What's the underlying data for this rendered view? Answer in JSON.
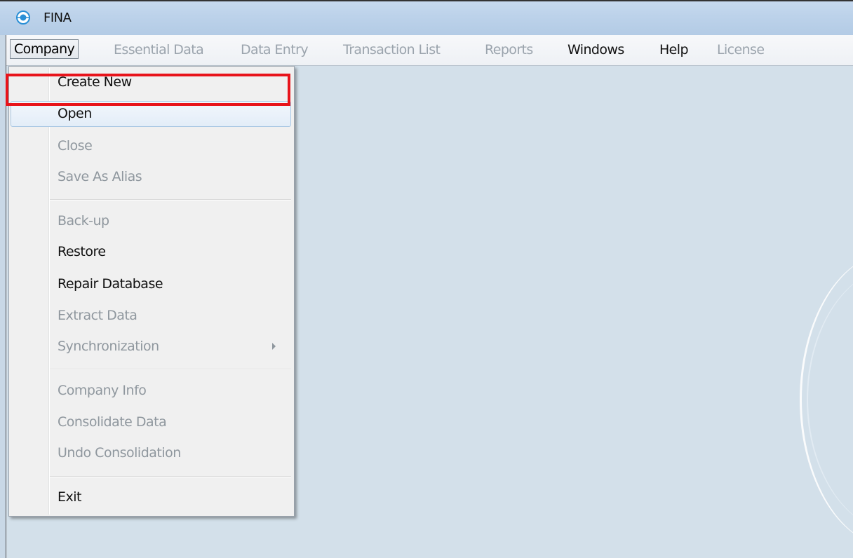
{
  "window": {
    "title": "FINA"
  },
  "menubar": {
    "items": [
      {
        "label": "Company",
        "state": "open"
      },
      {
        "label": "Essential Data",
        "state": "disabled"
      },
      {
        "label": "Data Entry",
        "state": "disabled"
      },
      {
        "label": "Transaction List",
        "state": "disabled"
      },
      {
        "label": "Reports",
        "state": "disabled"
      },
      {
        "label": "Windows",
        "state": "enabled"
      },
      {
        "label": "Help",
        "state": "enabled"
      },
      {
        "label": "License",
        "state": "disabled"
      }
    ]
  },
  "company_menu": {
    "items": [
      {
        "label": "Create New",
        "state": "enabled",
        "highlighted": true
      },
      {
        "label": "Open",
        "state": "enabled",
        "hovered": true
      },
      {
        "label": "Close",
        "state": "disabled"
      },
      {
        "label": "Save As Alias",
        "state": "disabled"
      },
      {
        "label": "Back-up",
        "state": "disabled"
      },
      {
        "label": "Restore",
        "state": "enabled"
      },
      {
        "label": "Repair Database",
        "state": "enabled"
      },
      {
        "label": "Extract Data",
        "state": "disabled"
      },
      {
        "label": "Synchronization",
        "state": "disabled",
        "submenu_icon": "chevron-right-icon"
      },
      {
        "label": "Company Info",
        "state": "disabled"
      },
      {
        "label": "Consolidate Data",
        "state": "disabled"
      },
      {
        "label": "Undo Consolidation",
        "state": "disabled"
      },
      {
        "label": "Exit",
        "state": "enabled"
      }
    ]
  },
  "colors": {
    "highlight_box": "#e8141b",
    "workspace": "#d3e0ea",
    "menu_background": "#f0f0f0",
    "disabled_text": "#8f979e"
  },
  "icons": {
    "app": "fina-app-icon"
  }
}
